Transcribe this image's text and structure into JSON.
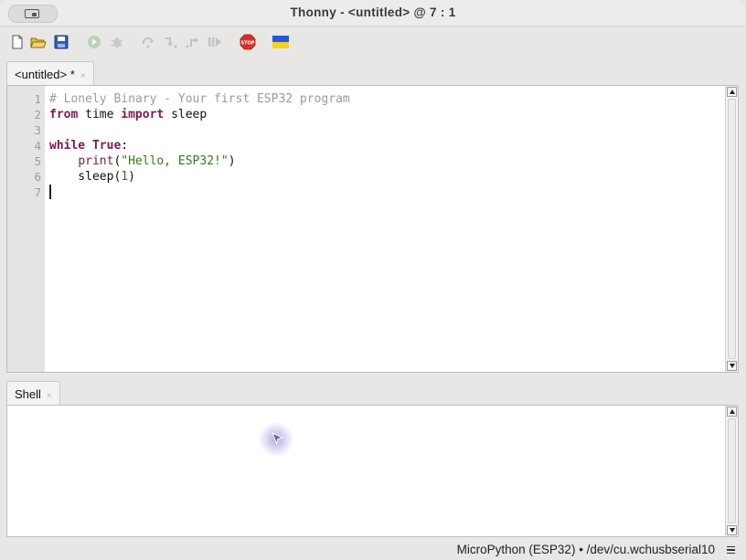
{
  "window": {
    "title": "Thonny  -  <untitled>  @  7 : 1"
  },
  "toolbar": {
    "buttons": [
      {
        "name": "new-file-icon"
      },
      {
        "name": "open-folder-icon"
      },
      {
        "name": "save-icon"
      },
      {
        "name": "run-icon"
      },
      {
        "name": "debug-icon"
      },
      {
        "name": "step-over-icon"
      },
      {
        "name": "step-into-icon"
      },
      {
        "name": "step-out-icon"
      },
      {
        "name": "resume-icon"
      },
      {
        "name": "stop-icon",
        "label": "STOP"
      },
      {
        "name": "ukraine-flag-icon"
      }
    ]
  },
  "editor": {
    "tab_label": "<untitled> *",
    "tab_close": "×",
    "line_numbers": [
      "1",
      "2",
      "3",
      "4",
      "5",
      "6",
      "7"
    ],
    "lines": [
      [
        {
          "t": "# Lonely Binary - Your first ESP32 program",
          "c": "cmt"
        }
      ],
      [
        {
          "t": "from",
          "c": "kw"
        },
        {
          "t": " time ",
          "c": ""
        },
        {
          "t": "import",
          "c": "kw"
        },
        {
          "t": " sleep",
          "c": ""
        }
      ],
      [],
      [
        {
          "t": "while",
          "c": "kw"
        },
        {
          "t": " ",
          "c": ""
        },
        {
          "t": "True",
          "c": "kw"
        },
        {
          "t": ":",
          "c": ""
        }
      ],
      [
        {
          "t": "    ",
          "c": ""
        },
        {
          "t": "print",
          "c": "bi"
        },
        {
          "t": "(",
          "c": ""
        },
        {
          "t": "\"Hello, ESP32!\"",
          "c": "str"
        },
        {
          "t": ")",
          "c": ""
        }
      ],
      [
        {
          "t": "    sleep(",
          "c": ""
        },
        {
          "t": "1",
          "c": "num"
        },
        {
          "t": ")",
          "c": ""
        }
      ],
      []
    ]
  },
  "shell": {
    "tab_label": "Shell",
    "tab_close": "×"
  },
  "status": {
    "text": "MicroPython (ESP32)  •  /dev/cu.wchusbserial10"
  },
  "colors": {
    "keyword": "#7a1a52",
    "string": "#2f7d1a",
    "comment": "#9b9b9b",
    "number": "#8a4a1a"
  }
}
